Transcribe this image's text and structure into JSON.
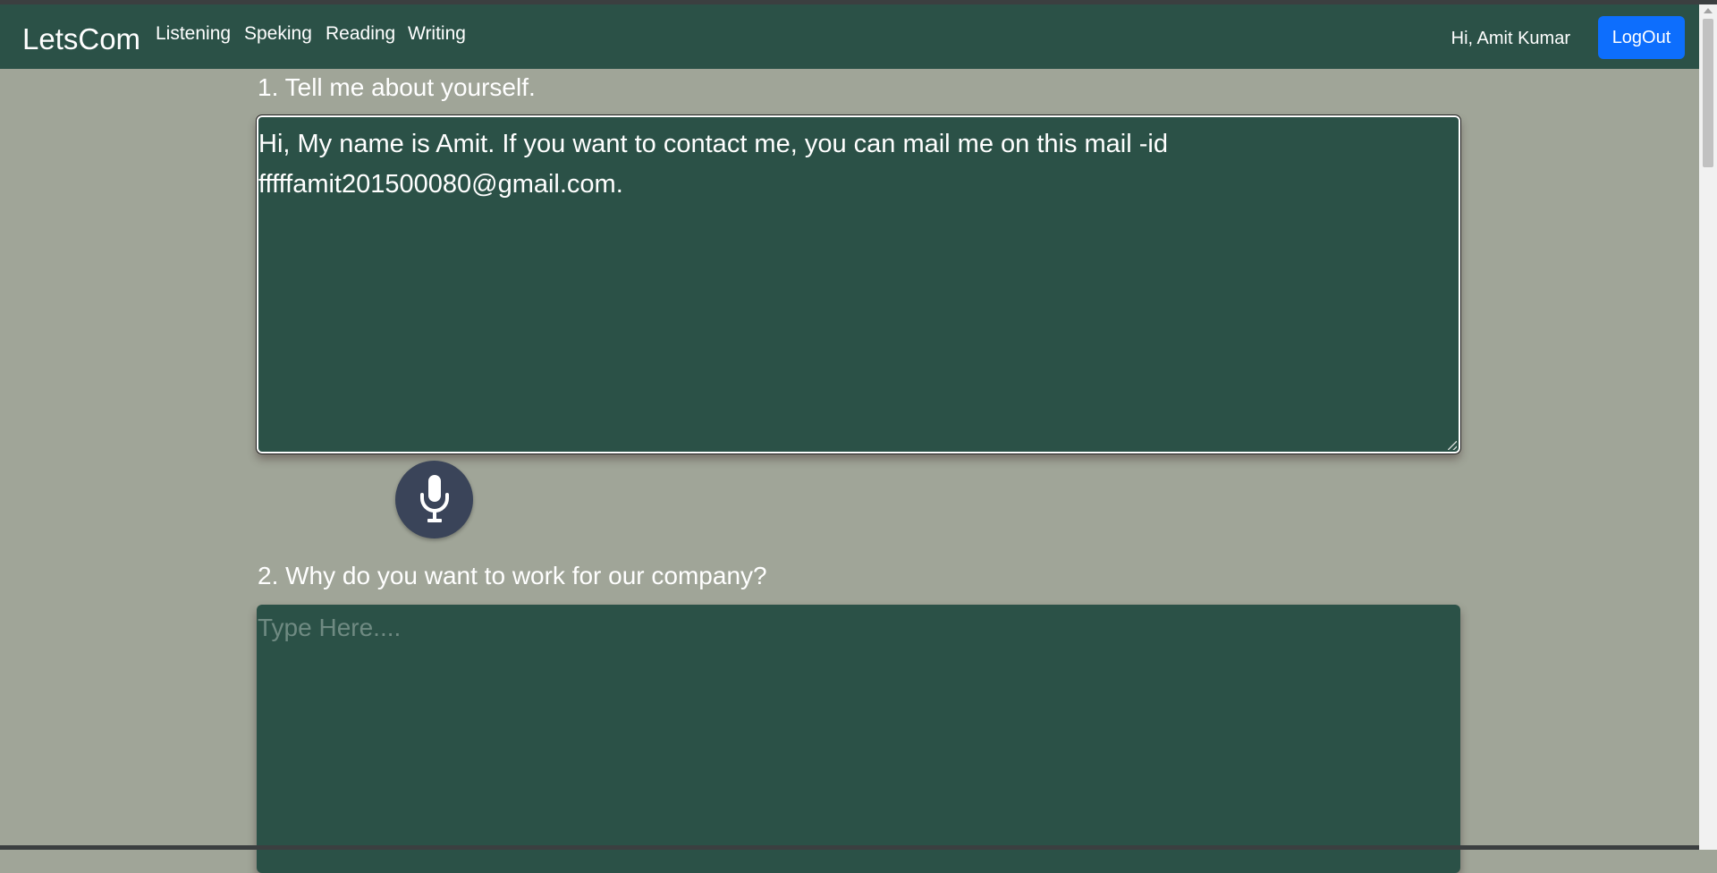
{
  "navbar": {
    "brand": "LetsCom",
    "links": [
      "Listening",
      "Speking",
      "Reading",
      "Writing"
    ],
    "greeting": "Hi, Amit Kumar",
    "logout_label": "LogOut"
  },
  "questions": [
    {
      "label": "1. Tell me about yourself.",
      "answer": "Hi, My name is Amit. If you want to contact me, you can mail me on this mail -id fffffamit201500080@gmail.com.",
      "placeholder": ""
    },
    {
      "label": "2. Why do you want to work for our company?",
      "answer": "",
      "placeholder": "Type Here...."
    }
  ],
  "icons": {
    "mic": "microphone-icon"
  },
  "colors": {
    "navbar": "#2b5147",
    "page_background": "#a0a598",
    "logout_button": "#0d6efd",
    "mic_button": "#3a4459"
  }
}
